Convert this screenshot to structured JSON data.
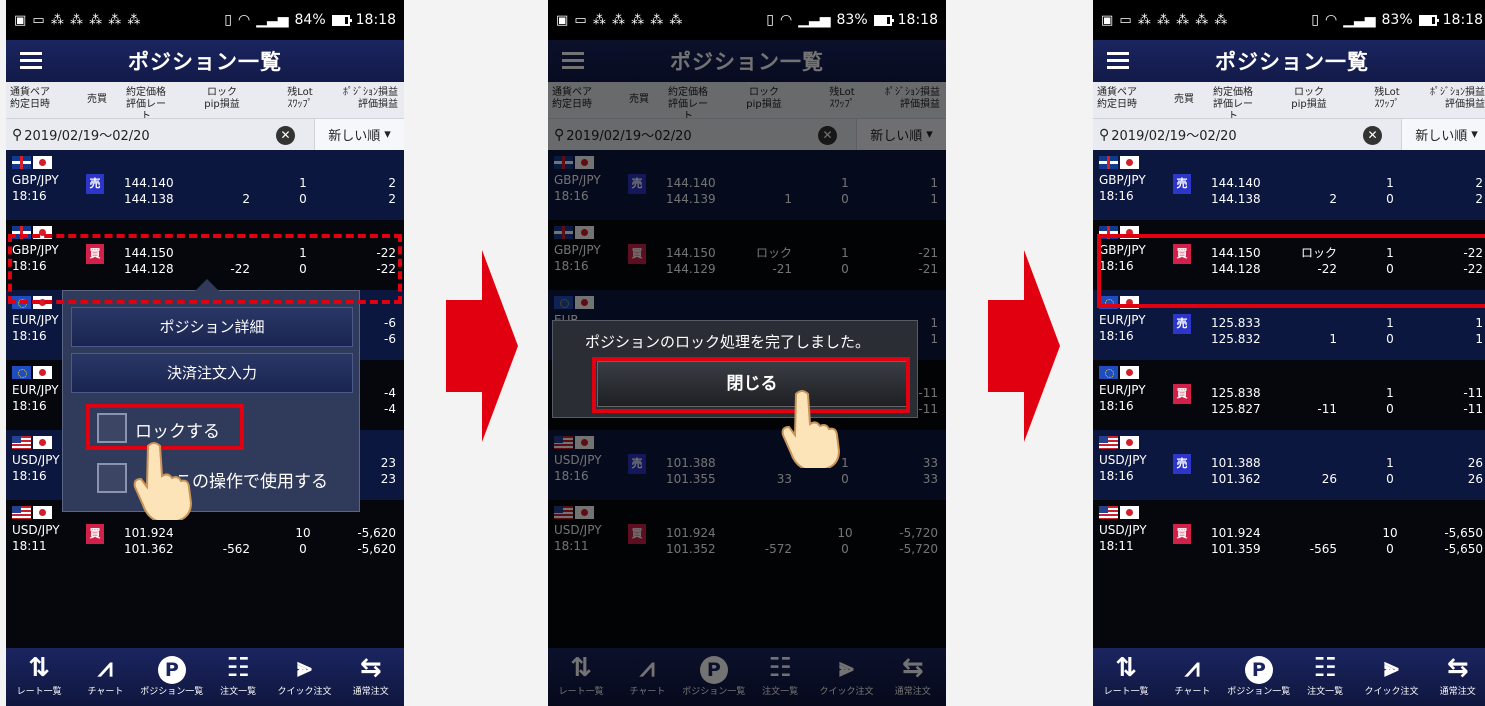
{
  "screens": [
    {
      "status": {
        "battery": "84%",
        "time": "18:18",
        "battery_level": 0.84
      },
      "title": "ポジション一覧",
      "columns": {
        "c1": [
          "通貨ペア",
          "約定日時"
        ],
        "c2": "売買",
        "c3": [
          "約定価格",
          "評価レート"
        ],
        "c4": [
          "ロック",
          "pip損益"
        ],
        "c5": [
          "残Lot",
          "ｽﾜｯﾌﾟ"
        ],
        "c6": [
          "ﾎﾟｼﾞｼｮﾝ損益",
          "評価損益"
        ]
      },
      "search": {
        "date_range": "2019/02/19～02/20",
        "clear": "✕",
        "sort": "新しい順"
      },
      "rows": [
        {
          "base_flag": "gb",
          "quote_flag": "jp",
          "pair": "GBP/JPY",
          "time": "18:16",
          "side": "売",
          "side_type": "sell",
          "price": "144.140",
          "rate": "144.138",
          "lock": "",
          "pip": "2",
          "lot": "1",
          "swap": "0",
          "pos_pnl": "2",
          "eval_pnl": "2"
        },
        {
          "base_flag": "gb",
          "quote_flag": "jp",
          "pair": "GBP/JPY",
          "time": "18:16",
          "side": "買",
          "side_type": "buy",
          "price": "144.150",
          "rate": "144.128",
          "lock": "",
          "pip": "-22",
          "lot": "1",
          "swap": "0",
          "pos_pnl": "-22",
          "eval_pnl": "-22"
        },
        {
          "base_flag": "eu",
          "quote_flag": "jp",
          "pair": "EUR/JPY",
          "time": "18:16",
          "side": "",
          "side_type": "sell",
          "price": "",
          "rate": "",
          "lock": "",
          "pip": "",
          "lot": "",
          "swap": "",
          "pos_pnl": "-6",
          "eval_pnl": "-6"
        },
        {
          "base_flag": "eu",
          "quote_flag": "jp",
          "pair": "EUR/JPY",
          "time": "18:16",
          "side": "",
          "side_type": "buy",
          "price": "",
          "rate": "",
          "lock": "",
          "pip": "",
          "lot": "",
          "swap": "",
          "pos_pnl": "-4",
          "eval_pnl": "-4"
        },
        {
          "base_flag": "us",
          "quote_flag": "jp",
          "pair": "USD/JPY",
          "time": "18:16",
          "side": "",
          "side_type": "sell",
          "price": "",
          "rate": "",
          "lock": "",
          "pip": "",
          "lot": "",
          "swap": "",
          "pos_pnl": "23",
          "eval_pnl": "23"
        },
        {
          "base_flag": "us",
          "quote_flag": "jp",
          "pair": "USD/JPY",
          "time": "18:11",
          "side": "買",
          "side_type": "buy",
          "price": "101.924",
          "rate": "101.362",
          "lock": "",
          "pip": "-562",
          "lot": "10",
          "swap": "0",
          "pos_pnl": "-5,620",
          "eval_pnl": "-5,620"
        }
      ],
      "menu": {
        "detail": "ポジション詳細",
        "settle": "決済注文入力",
        "lock_label": "ロックする",
        "use_label": "この操作で使用する"
      }
    },
    {
      "status": {
        "battery": "83%",
        "time": "18:18",
        "battery_level": 0.83
      },
      "title": "ポジション一覧",
      "columns": {
        "c1": [
          "通貨ペア",
          "約定日時"
        ],
        "c2": "売買",
        "c3": [
          "約定価格",
          "評価レート"
        ],
        "c4": [
          "ロック",
          "pip損益"
        ],
        "c5": [
          "残Lot",
          "ｽﾜｯﾌﾟ"
        ],
        "c6": [
          "ﾎﾟｼﾞｼｮﾝ損益",
          "評価損益"
        ]
      },
      "search": {
        "date_range": "2019/02/19～02/20",
        "clear": "✕",
        "sort": "新しい順"
      },
      "rows": [
        {
          "base_flag": "gb",
          "quote_flag": "jp",
          "pair": "GBP/JPY",
          "time": "18:16",
          "side": "売",
          "side_type": "sell",
          "price": "144.140",
          "rate": "144.139",
          "lock": "",
          "pip": "1",
          "lot": "1",
          "swap": "0",
          "pos_pnl": "1",
          "eval_pnl": "1"
        },
        {
          "base_flag": "gb",
          "quote_flag": "jp",
          "pair": "GBP/JPY",
          "time": "18:16",
          "side": "買",
          "side_type": "buy",
          "price": "144.150",
          "rate": "144.129",
          "lock": "ロック",
          "pip": "-21",
          "lot": "1",
          "swap": "0",
          "pos_pnl": "-21",
          "eval_pnl": "-21"
        },
        {
          "base_flag": "eu",
          "quote_flag": "jp",
          "pair": "EUR",
          "time": "18:",
          "side": "",
          "side_type": "sell",
          "price": "",
          "rate": "",
          "lock": "",
          "pip": "",
          "lot": "",
          "swap": "",
          "pos_pnl": "1",
          "eval_pnl": "1"
        },
        {
          "base_flag": "eu",
          "quote_flag": "jp",
          "pair": "EUR",
          "time": "18:16",
          "side": "",
          "side_type": "buy",
          "price": "",
          "rate": "",
          "lock": "",
          "pip": "",
          "lot": "",
          "swap": "",
          "pos_pnl": "-11",
          "eval_pnl": "-11"
        },
        {
          "base_flag": "us",
          "quote_flag": "jp",
          "pair": "USD/JPY",
          "time": "18:16",
          "side": "売",
          "side_type": "sell",
          "price": "101.388",
          "rate": "101.355",
          "lock": "",
          "pip": "33",
          "lot": "1",
          "swap": "0",
          "pos_pnl": "33",
          "eval_pnl": "33"
        },
        {
          "base_flag": "us",
          "quote_flag": "jp",
          "pair": "USD/JPY",
          "time": "18:11",
          "side": "買",
          "side_type": "buy",
          "price": "101.924",
          "rate": "101.352",
          "lock": "",
          "pip": "-572",
          "lot": "10",
          "swap": "0",
          "pos_pnl": "-5,720",
          "eval_pnl": "-5,720"
        }
      ],
      "dialog": {
        "message": "ポジションのロック処理を完了しました。",
        "close": "閉じる"
      }
    },
    {
      "status": {
        "battery": "83%",
        "time": "18:18",
        "battery_level": 0.83
      },
      "title": "ポジション一覧",
      "columns": {
        "c1": [
          "通貨ペア",
          "約定日時"
        ],
        "c2": "売買",
        "c3": [
          "約定価格",
          "評価レート"
        ],
        "c4": [
          "ロック",
          "pip損益"
        ],
        "c5": [
          "残Lot",
          "ｽﾜｯﾌﾟ"
        ],
        "c6": [
          "ﾎﾟｼﾞｼｮﾝ損益",
          "評価損益"
        ]
      },
      "search": {
        "date_range": "2019/02/19～02/20",
        "clear": "✕",
        "sort": "新しい順"
      },
      "rows": [
        {
          "base_flag": "gb",
          "quote_flag": "jp",
          "pair": "GBP/JPY",
          "time": "18:16",
          "side": "売",
          "side_type": "sell",
          "price": "144.140",
          "rate": "144.138",
          "lock": "",
          "pip": "2",
          "lot": "1",
          "swap": "0",
          "pos_pnl": "2",
          "eval_pnl": "2"
        },
        {
          "base_flag": "gb",
          "quote_flag": "jp",
          "pair": "GBP/JPY",
          "time": "18:16",
          "side": "買",
          "side_type": "buy",
          "price": "144.150",
          "rate": "144.128",
          "lock": "ロック",
          "pip": "-22",
          "lot": "1",
          "swap": "0",
          "pos_pnl": "-22",
          "eval_pnl": "-22"
        },
        {
          "base_flag": "eu",
          "quote_flag": "jp",
          "pair": "EUR/JPY",
          "time": "18:16",
          "side": "売",
          "side_type": "sell",
          "price": "125.833",
          "rate": "125.832",
          "lock": "",
          "pip": "1",
          "lot": "1",
          "swap": "0",
          "pos_pnl": "1",
          "eval_pnl": "1"
        },
        {
          "base_flag": "eu",
          "quote_flag": "jp",
          "pair": "EUR/JPY",
          "time": "18:16",
          "side": "買",
          "side_type": "buy",
          "price": "125.838",
          "rate": "125.827",
          "lock": "",
          "pip": "-11",
          "lot": "1",
          "swap": "0",
          "pos_pnl": "-11",
          "eval_pnl": "-11"
        },
        {
          "base_flag": "us",
          "quote_flag": "jp",
          "pair": "USD/JPY",
          "time": "18:16",
          "side": "売",
          "side_type": "sell",
          "price": "101.388",
          "rate": "101.362",
          "lock": "",
          "pip": "26",
          "lot": "1",
          "swap": "0",
          "pos_pnl": "26",
          "eval_pnl": "26"
        },
        {
          "base_flag": "us",
          "quote_flag": "jp",
          "pair": "USD/JPY",
          "time": "18:11",
          "side": "買",
          "side_type": "buy",
          "price": "101.924",
          "rate": "101.359",
          "lock": "",
          "pip": "-565",
          "lot": "10",
          "swap": "0",
          "pos_pnl": "-5,650",
          "eval_pnl": "-5,650"
        }
      ]
    }
  ],
  "nav": [
    {
      "label": "レート一覧",
      "icon": "rate-list-icon",
      "glyph": "⇅"
    },
    {
      "label": "チャート",
      "icon": "chart-icon",
      "glyph": "⩘"
    },
    {
      "label": "ポジション一覧",
      "icon": "position-icon",
      "glyph": "P"
    },
    {
      "label": "注文一覧",
      "icon": "order-list-icon",
      "glyph": "☷"
    },
    {
      "label": "クイック注文",
      "icon": "quick-order-icon",
      "glyph": "⫸"
    },
    {
      "label": "通常注文",
      "icon": "normal-order-icon",
      "glyph": "⇆"
    }
  ],
  "colors": {
    "highlight": "#e00010",
    "navy": "#1b2560",
    "sell": "#2d36c8",
    "buy": "#d1204a"
  }
}
